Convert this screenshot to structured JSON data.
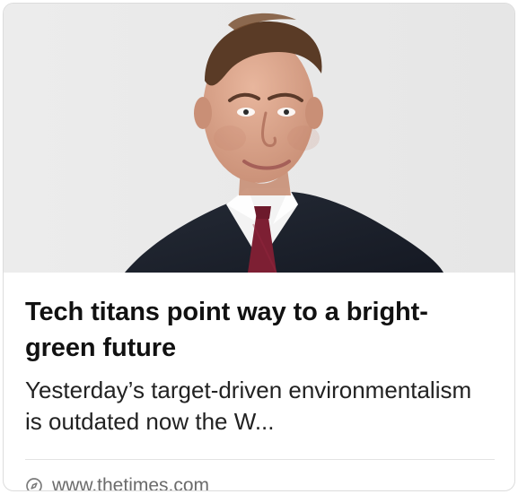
{
  "card": {
    "image_alt": "portrait-photo",
    "headline": "Tech titans point way to a bright-green future",
    "snippet": "Yesterday’s target-driven environmentalism is outdated now the W...",
    "url": "www.thetimes.com"
  },
  "icons": {
    "url_icon": "compass-icon"
  },
  "colors": {
    "hero_bg": "#e9e9e9",
    "suit": "#1f2430",
    "shirt": "#f1f1f1",
    "tie": "#7d1f33",
    "skin": "#d7a48b",
    "hair": "#5a3b26"
  }
}
